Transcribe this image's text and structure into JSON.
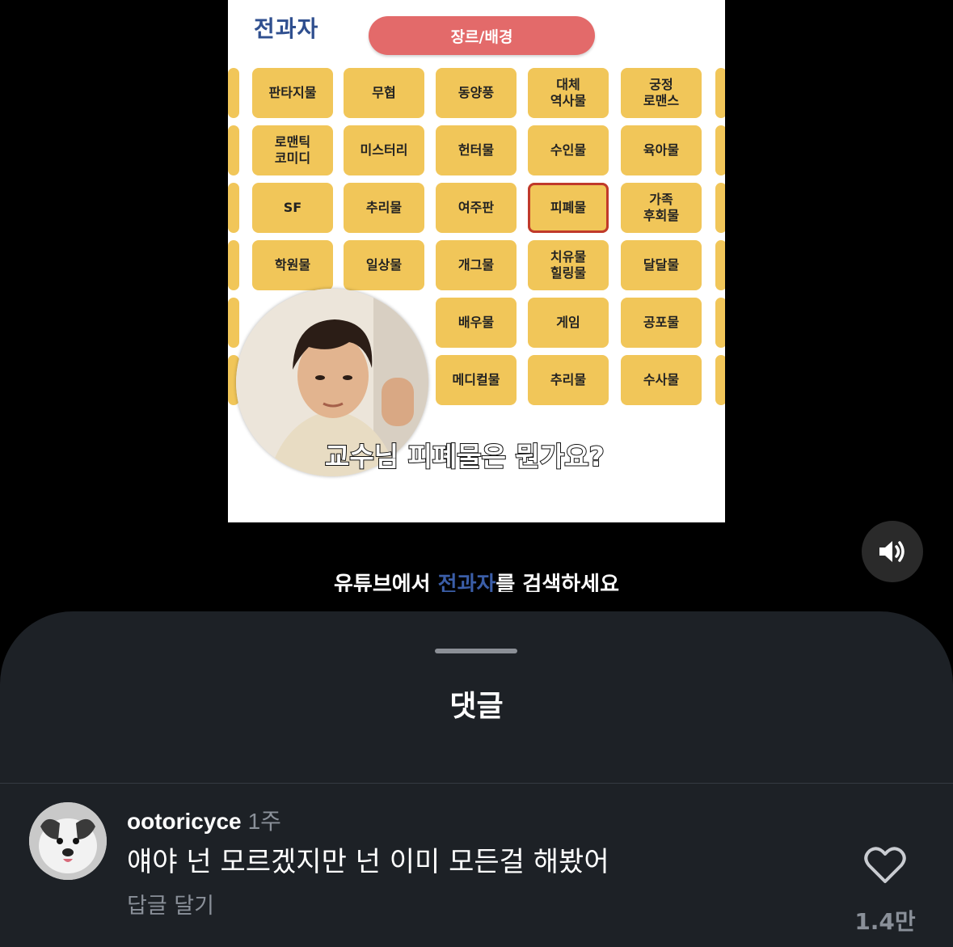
{
  "video": {
    "channel_logo": "전과자",
    "genre_pill": "장르/배경",
    "genre_rows": [
      [
        "판타지물",
        "무협",
        "동양풍",
        "대체\n역사물",
        "궁정\n로맨스"
      ],
      [
        "로맨틱\n코미디",
        "미스터리",
        "헌터물",
        "수인물",
        "육아물"
      ],
      [
        "SF",
        "추리물",
        "여주판",
        "피폐물",
        "가족\n후회물"
      ],
      [
        "학원물",
        "일상물",
        "개그물",
        "치유물\n힐링물",
        "달달물"
      ],
      [
        "",
        "",
        "배우물",
        "게임",
        "공포물"
      ],
      [
        "",
        "",
        "메디컬물",
        "추리물",
        "수사물"
      ]
    ],
    "highlighted_genre": "피폐물",
    "subtitle": "교수님 피폐물은 뭔가요?",
    "bottom_text_before": "유튜브에서 ",
    "bottom_text_highlight": "전과자",
    "bottom_text_after": "를 검색하세요"
  },
  "controls": {
    "volume_icon": "speaker-on-icon"
  },
  "comments_sheet": {
    "title": "댓글",
    "comments": [
      {
        "username": "ootoricyce",
        "time": "1주",
        "text": "얘야 넌 모르겠지만 넌 이미 모든걸 해봤어",
        "reply_label": "답글 달기",
        "like_count": "1.4만",
        "like_icon": "heart-outline-icon"
      }
    ]
  },
  "colors": {
    "tile": "#f1c659",
    "pill": "#e36a6a",
    "highlight_border": "#c0392b",
    "sheet_bg": "#1d2126",
    "muted_text": "#8a9099"
  }
}
